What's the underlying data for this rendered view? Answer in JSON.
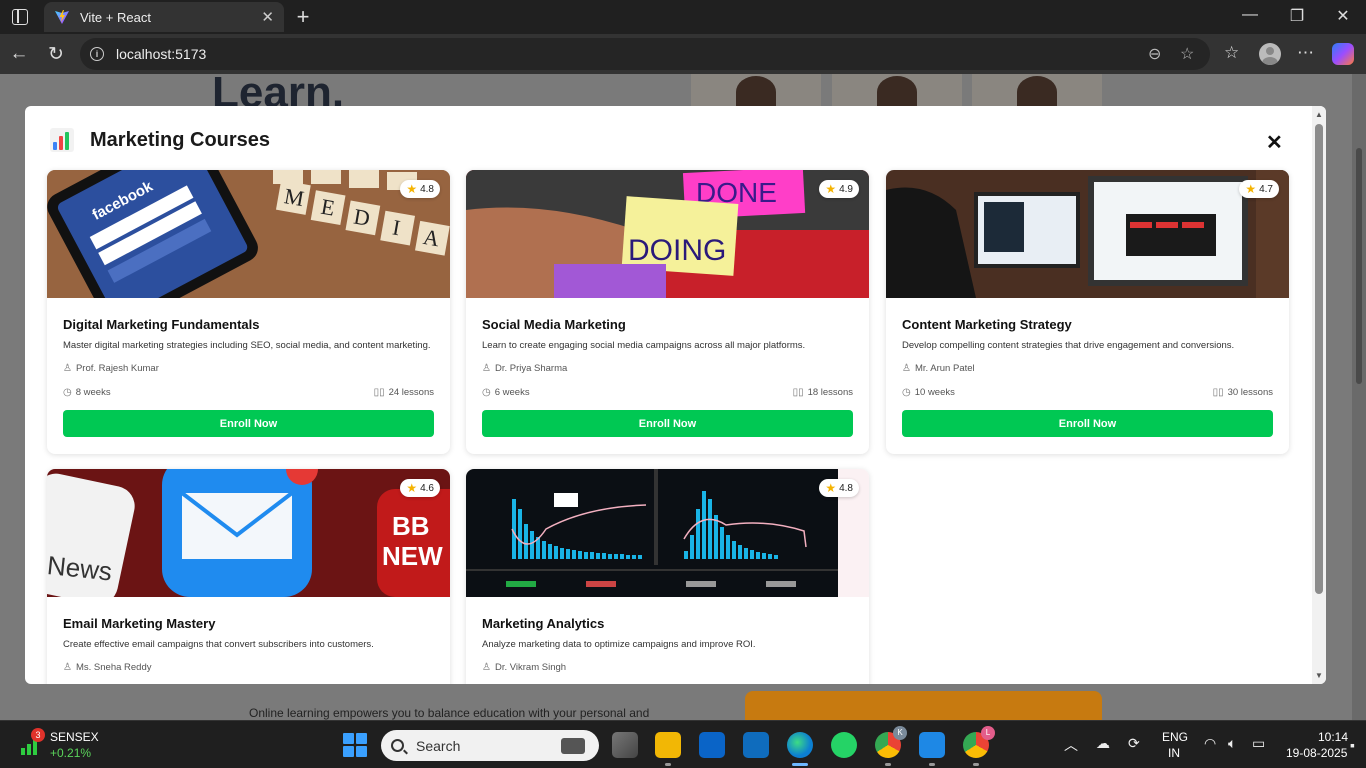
{
  "browser": {
    "tab_title": "Vite + React",
    "url": "localhost:5173",
    "new_tab_glyph": "+",
    "close_glyph": "✕"
  },
  "background_page": {
    "heading_fragment": "Learn.",
    "paragraph_fragment": "Online learning empowers you to balance education with your personal and"
  },
  "modal": {
    "title": "Marketing Courses",
    "icon": "bar-chart-emoji",
    "close_glyph": "✕",
    "courses": [
      {
        "title": "Digital Marketing Fundamentals",
        "description": "Master digital marketing strategies including SEO, social media, and content marketing.",
        "instructor": "Prof. Rajesh Kumar",
        "duration": "8 weeks",
        "lessons": "24 lessons",
        "rating": "4.8",
        "cta": "Enroll Now",
        "image": "facebook-phone-scrabble"
      },
      {
        "title": "Social Media Marketing",
        "description": "Learn to create engaging social media campaigns across all major platforms.",
        "instructor": "Dr. Priya Sharma",
        "duration": "6 weeks",
        "lessons": "18 lessons",
        "rating": "4.9",
        "cta": "Enroll Now",
        "image": "sticky-notes-done-doing"
      },
      {
        "title": "Content Marketing Strategy",
        "description": "Develop compelling content strategies that drive engagement and conversions.",
        "instructor": "Mr. Arun Patel",
        "duration": "10 weeks",
        "lessons": "30 lessons",
        "rating": "4.7",
        "cta": "Enroll Now",
        "image": "monitors-dashboard"
      },
      {
        "title": "Email Marketing Mastery",
        "description": "Create effective email campaigns that convert subscribers into customers.",
        "instructor": "Ms. Sneha Reddy",
        "rating": "4.6",
        "image": "mail-app-icons"
      },
      {
        "title": "Marketing Analytics",
        "description": "Analyze marketing data to optimize campaigns and improve ROI.",
        "instructor": "Dr. Vikram Singh",
        "rating": "4.8",
        "image": "analytics-histogram-dashboard"
      }
    ]
  },
  "taskbar": {
    "widget_name": "SENSEX",
    "widget_value": "+0.21%",
    "widget_badge": "3",
    "search_placeholder": "Search",
    "language_1": "ENG",
    "language_2": "IN",
    "time": "10:14",
    "date": "19-08-2025",
    "chrome_badge_1": "K",
    "chrome_badge_2": "L"
  },
  "colors": {
    "enroll_button": "#00c853",
    "star": "#f5b301",
    "taskbar": "#1f1f1f",
    "accent_blue": "#3aa0ff"
  }
}
